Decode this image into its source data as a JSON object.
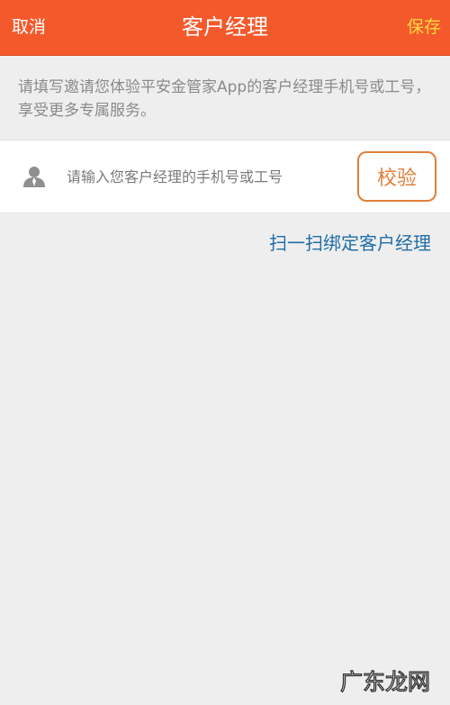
{
  "navbar": {
    "cancel_label": "取消",
    "title": "客户经理",
    "save_label": "保存"
  },
  "intro_text": "请填写邀请您体验平安金管家App的客户经理手机号或工号，享受更多专属服务。",
  "input": {
    "placeholder": "请输入您客户经理的手机号或工号",
    "value": ""
  },
  "verify_label": "校验",
  "scan_label": "扫一扫绑定客户经理",
  "watermark_text": "广东龙网",
  "colors": {
    "nav_bg": "#f4592b",
    "save": "#ffd93f",
    "accent": "#e07f3a",
    "link": "#1f6ea7"
  },
  "icons": {
    "user": "person-icon"
  }
}
